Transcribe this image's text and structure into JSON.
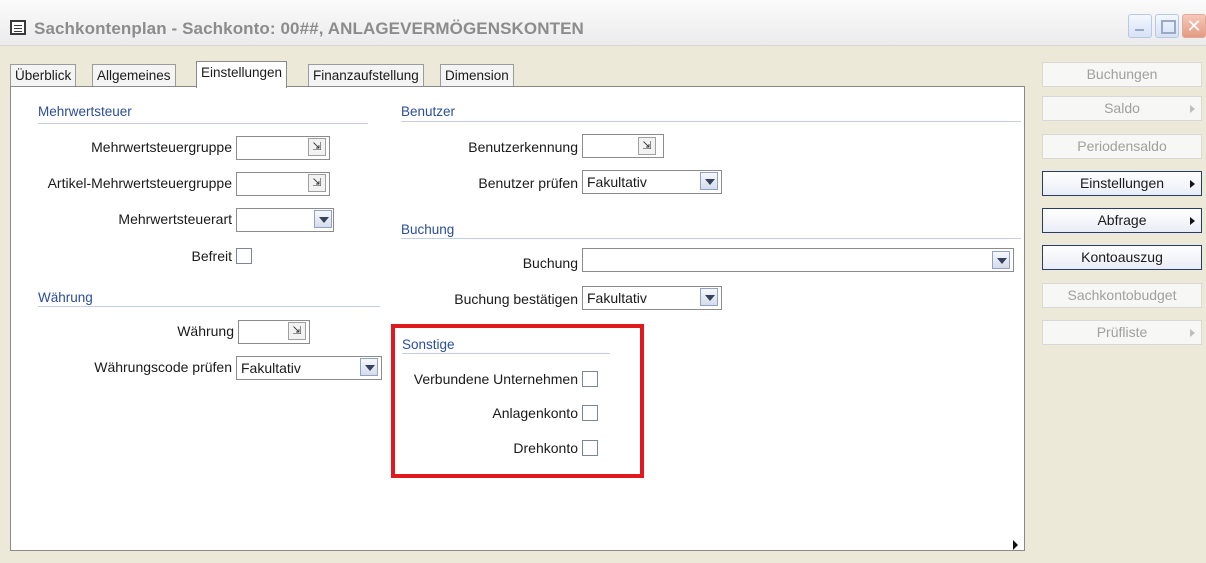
{
  "window": {
    "title": "Sachkontenplan - Sachkonto: 00##, ANLAGEVERMÖGENSKONTEN",
    "controls": {
      "close": "✕"
    }
  },
  "tabs": [
    "Überblick",
    "Allgemeines",
    "Einstellungen",
    "Finanzaufstellung",
    "Dimension"
  ],
  "active_tab": "Einstellungen",
  "mehrwertsteuer": {
    "title": "Mehrwertsteuer",
    "gruppe_label": "Mehrwertsteuergruppe",
    "gruppe_value": "",
    "artikel_label": "Artikel-Mehrwertsteuergruppe",
    "artikel_value": "",
    "art_label": "Mehrwertsteuerart",
    "art_value": "",
    "befreit_label": "Befreit",
    "befreit_checked": false
  },
  "waehrung": {
    "title": "Währung",
    "waehrung_label": "Währung",
    "waehrung_value": "",
    "code_pruefen_label": "Währungscode prüfen",
    "code_pruefen_value": "Fakultativ"
  },
  "benutzer": {
    "title": "Benutzer",
    "kennung_label": "Benutzerkennung",
    "kennung_value": "",
    "pruefen_label": "Benutzer prüfen",
    "pruefen_value": "Fakultativ"
  },
  "buchung": {
    "title": "Buchung",
    "buchung_label": "Buchung",
    "buchung_value": "",
    "bestaetigen_label": "Buchung bestätigen",
    "bestaetigen_value": "Fakultativ"
  },
  "sonstige": {
    "title": "Sonstige",
    "verbundene_label": "Verbundene Unternehmen",
    "verbundene_checked": false,
    "anlagenkonto_label": "Anlagenkonto",
    "anlagenkonto_checked": false,
    "drehkonto_label": "Drehkonto",
    "drehkonto_checked": false
  },
  "sidebar": [
    {
      "label": "Buchungen",
      "enabled": false,
      "arrow": false
    },
    {
      "label": "Saldo",
      "enabled": false,
      "arrow": true
    },
    {
      "label": "Periodensaldo",
      "enabled": false,
      "arrow": false
    },
    {
      "label": "Einstellungen",
      "enabled": true,
      "arrow": true
    },
    {
      "label": "Abfrage",
      "enabled": true,
      "arrow": true
    },
    {
      "label": "Kontoauszug",
      "enabled": true,
      "arrow": false
    },
    {
      "label": "Sachkontobudget",
      "enabled": false,
      "arrow": false
    },
    {
      "label": "Prüfliste",
      "enabled": false,
      "arrow": true
    }
  ],
  "colors": {
    "highlight_box": "#e0191f",
    "section_title": "#2b4d9c"
  }
}
